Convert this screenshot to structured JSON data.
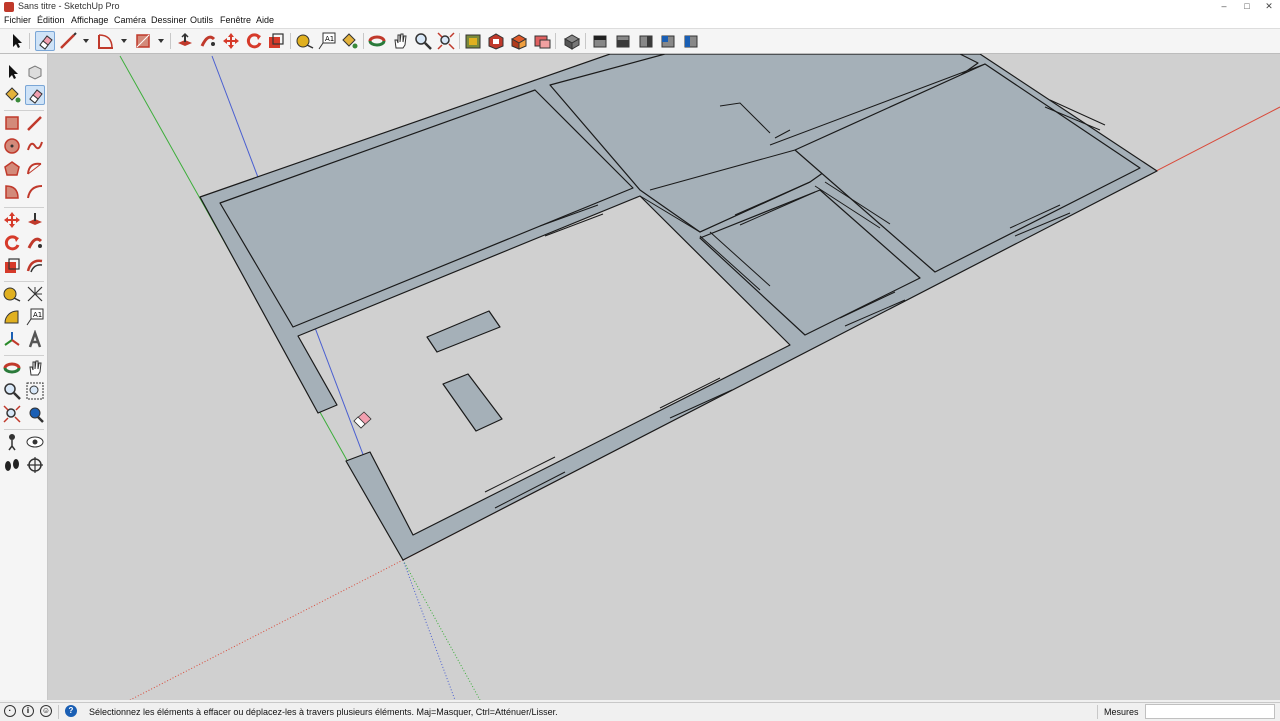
{
  "window": {
    "title": "Sans titre - SketchUp Pro"
  },
  "menu": [
    "Fichier",
    "Édition",
    "Affichage",
    "Caméra",
    "Dessiner",
    "Outils",
    "Fenêtre",
    "Aide"
  ],
  "toolbar": {
    "tools": [
      "select",
      "eraser",
      "line",
      "arc",
      "rectangle",
      "push-pull",
      "follow-me",
      "move",
      "rotate",
      "scale",
      "tape-measure",
      "text",
      "paint-bucket",
      "orbit",
      "pan",
      "zoom",
      "zoom-extents",
      "warehouse",
      "extension-warehouse",
      "components",
      "styles",
      "views-iso",
      "views-top",
      "views-front",
      "views-right",
      "views-back",
      "views-left"
    ],
    "active_tool": "eraser"
  },
  "sidebar": {
    "tools": [
      "select",
      "make-component",
      "paint-bucket",
      "eraser",
      "rectangle",
      "line",
      "circle",
      "freehand",
      "polygon",
      "arc",
      "pie",
      "two-point-arc",
      "move",
      "push-pull",
      "rotate",
      "follow-me",
      "scale",
      "offset",
      "tape-measure",
      "dimension",
      "protractor",
      "text",
      "axes",
      "3d-text",
      "orbit",
      "pan",
      "zoom",
      "zoom-window",
      "zoom-extents",
      "previous-view",
      "position-camera",
      "look-around",
      "walk",
      "section-plane"
    ],
    "active_tool": "eraser"
  },
  "colors": {
    "face_gray": "#a5b0b8",
    "ground": "#d0d0d0",
    "axis_red": "#d94a3a",
    "axis_green": "#3cae3a",
    "axis_blue": "#4a5fd0",
    "accent": "#cfe3f7"
  },
  "status": {
    "hint": "Sélectionnez les éléments à effacer ou déplacez-les à travers plusieurs éléments. Maj=Masquer, Ctrl=Atténuer/Lisser.",
    "measures_label": "Mesures",
    "measures_value": ""
  }
}
